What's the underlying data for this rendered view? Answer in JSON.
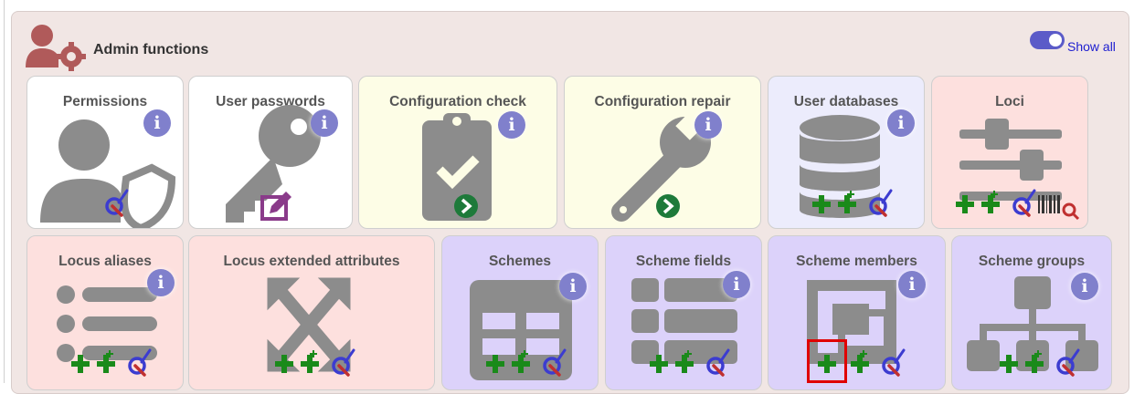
{
  "panel": {
    "title": "Admin functions",
    "header_icon": "user-cog-icon",
    "show_all": {
      "label": "Show all",
      "state": "on"
    }
  },
  "colors": {
    "white_card": "#ffffff",
    "config_card": "#fdfde6",
    "user_db_card": "#ececfc",
    "loci_card": "#fde0de",
    "scheme_card": "#dcd2fa",
    "add_icon": "#1a8a1a",
    "info_icon": "#8080cc",
    "highlight": "#e00000"
  },
  "cards": [
    {
      "title": "Permissions",
      "info": "i",
      "icons": [
        "user-shield-icon",
        "query-icon"
      ]
    },
    {
      "title": "User passwords",
      "info": "i",
      "icons": [
        "key-icon",
        "edit-icon"
      ]
    },
    {
      "title": "Configuration check",
      "info": "i",
      "icons": [
        "clipboard-check-icon",
        "go-icon"
      ]
    },
    {
      "title": "Configuration repair",
      "info": "i",
      "icons": [
        "wrench-icon",
        "go-icon"
      ]
    },
    {
      "title": "User databases",
      "info": "i",
      "icons": [
        "database-icon",
        "add-icon",
        "batch-add-icon",
        "query-icon"
      ]
    },
    {
      "title": "Loci",
      "info": "i",
      "icons": [
        "sliders-icon",
        "add-icon",
        "batch-add-icon",
        "query-icon",
        "barcode-search-icon"
      ]
    },
    {
      "title": "Locus aliases",
      "info": "i",
      "icons": [
        "list-icon",
        "add-icon",
        "batch-add-icon",
        "query-icon"
      ]
    },
    {
      "title": "Locus extended attributes",
      "info": "",
      "icons": [
        "expand-arrows-icon",
        "add-icon",
        "batch-add-icon",
        "query-icon"
      ]
    },
    {
      "title": "Schemes",
      "info": "i",
      "icons": [
        "table-icon",
        "add-icon",
        "batch-add-icon",
        "query-icon"
      ]
    },
    {
      "title": "Scheme fields",
      "info": "i",
      "icons": [
        "th-list-icon",
        "add-icon",
        "batch-add-icon",
        "query-icon"
      ]
    },
    {
      "title": "Scheme members",
      "info": "i",
      "icons": [
        "object-group-icon",
        "add-icon",
        "batch-add-icon",
        "query-icon"
      ]
    },
    {
      "title": "Scheme groups",
      "info": "i",
      "icons": [
        "sitemap-icon",
        "add-icon",
        "batch-add-icon",
        "query-icon"
      ]
    }
  ]
}
